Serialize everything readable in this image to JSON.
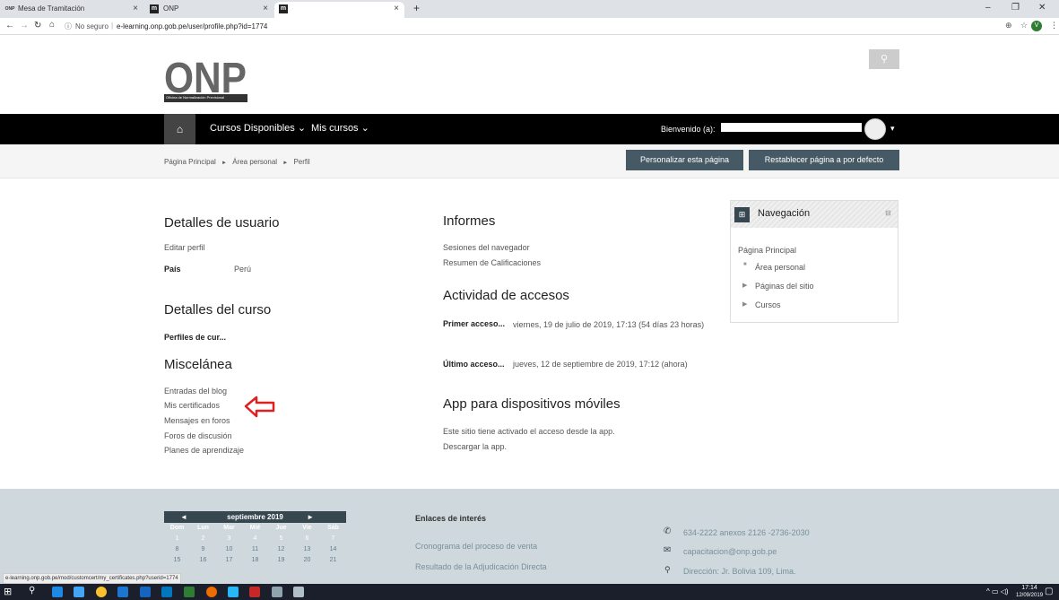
{
  "browser": {
    "tabs": [
      {
        "label": "Mesa de Tramitación",
        "favicon": "ONP"
      },
      {
        "label": "ONP",
        "favicon": "m"
      },
      {
        "label": "",
        "favicon": "m"
      }
    ],
    "new_tab": "+",
    "url_security": "No seguro",
    "url": "e-learning.onp.gob.pe/user/profile.php?id=1774",
    "profile_initial": "V"
  },
  "site": {
    "logo_text": "ONP",
    "logo_subtitle": "Oficina de Normalización Previsional",
    "nav": {
      "cursos": "Cursos Disponibles",
      "mis_cursos": "Mis cursos",
      "welcome": "Bienvenido (a):"
    },
    "breadcrumbs": [
      "Página Principal",
      "Área personal",
      "Perfil"
    ],
    "breadcrumb_sep": "►",
    "buttons": {
      "customize": "Personalizar esta página",
      "reset": "Restablecer página a por defecto"
    }
  },
  "left": {
    "user_details_title": "Detalles de usuario",
    "edit_profile": "Editar perfil",
    "country_label": "País",
    "country_value": "Perú",
    "course_details_title": "Detalles del curso",
    "course_profiles": "Perfiles de cur...",
    "misc_title": "Miscelánea",
    "misc_links": [
      "Entradas del blog",
      "Mis certificados",
      "Mensajes en foros",
      "Foros de discusión",
      "Planes de aprendizaje"
    ]
  },
  "middle": {
    "reports_title": "Informes",
    "reports_links": [
      "Sesiones del navegador",
      "Resumen de Calificaciones"
    ],
    "access_title": "Actividad de accesos",
    "first_access_label": "Primer acceso...",
    "first_access_value": "viernes, 19 de julio de 2019, 17:13  (54 días 23 horas)",
    "last_access_label": "Último acceso...",
    "last_access_value": "jueves, 12 de septiembre de 2019, 17:12  (ahora)",
    "mobile_title": "App para dispositivos móviles",
    "mobile_text": "Este sitio tiene activado el acceso desde la app.",
    "mobile_link": "Descargar la app."
  },
  "navigation_block": {
    "title": "Navegación",
    "home": "Página Principal",
    "items": [
      "Área personal",
      "Páginas del sitio",
      "Cursos"
    ]
  },
  "footer": {
    "calendar_month": "septiembre 2019",
    "day_names": [
      "Dom",
      "Lun",
      "Mar",
      "Mié",
      "Jue",
      "Vie",
      "Sáb"
    ],
    "weeks": [
      [
        "1",
        "2",
        "3",
        "4",
        "5",
        "6",
        "7"
      ],
      [
        "8",
        "9",
        "10",
        "11",
        "12",
        "13",
        "14"
      ],
      [
        "15",
        "16",
        "17",
        "18",
        "19",
        "20",
        "21"
      ]
    ],
    "links_title": "Enlaces de interés",
    "links": [
      "Cronograma del proceso de venta",
      "Resultado de la Adjudicación Directa"
    ],
    "phone": "634-2222 anexos 2126 -2736-2030",
    "email": "capacitacion@onp.gob.pe",
    "address": "Dirección: Jr. Bolivia 109, Lima."
  },
  "status_url": "e-learning.onp.gob.pe/mod/customcert/my_certificates.php?userid=1774",
  "taskbar": {
    "time": "17:14",
    "date": "12/09/2019"
  },
  "colors": {
    "navbar": "#000000",
    "button": "#455a64",
    "footer": "#cfd8dc",
    "arrow": "#e02020"
  }
}
